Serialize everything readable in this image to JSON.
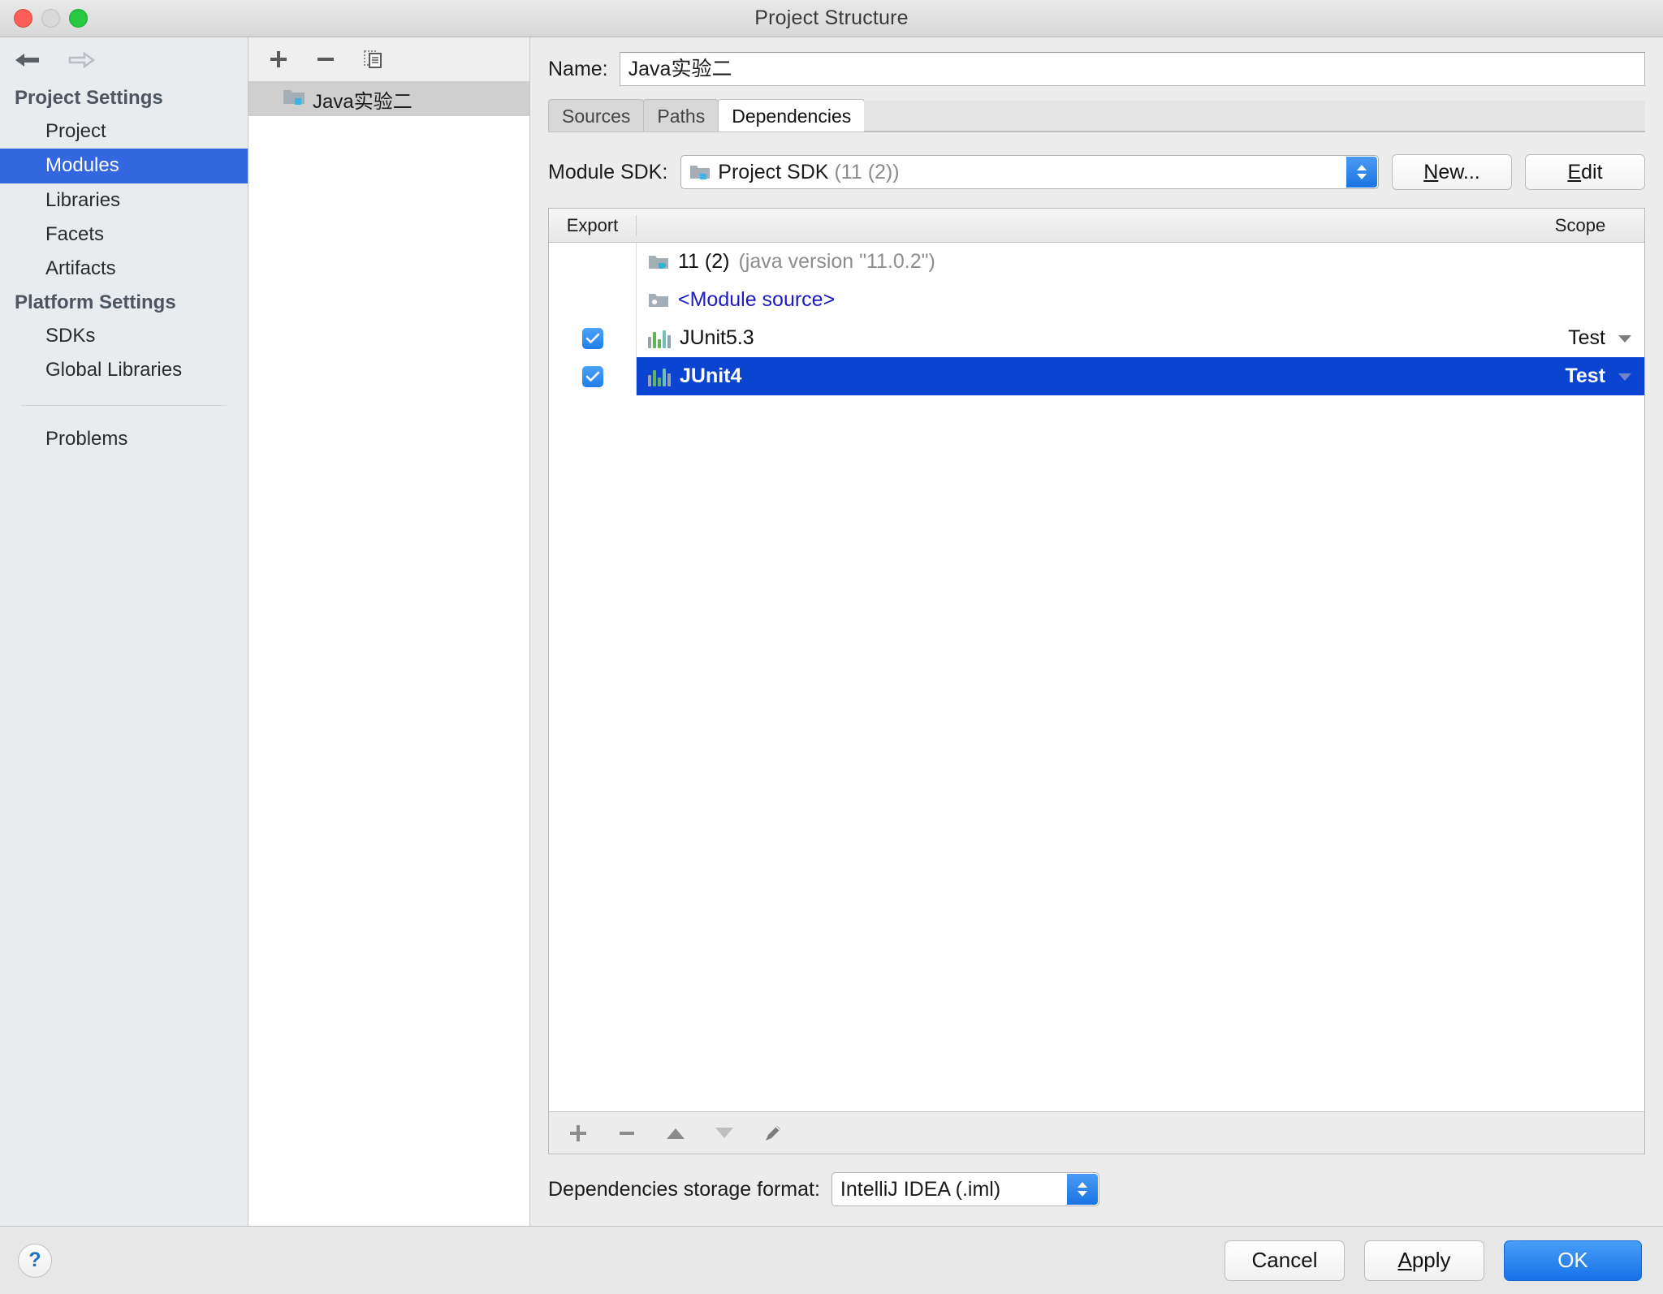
{
  "window": {
    "title": "Project Structure",
    "traffic_lights": [
      "close",
      "minimize",
      "maximize"
    ]
  },
  "nav": {
    "back_icon": "arrow-left-icon",
    "forward_icon": "arrow-right-icon",
    "sections": [
      {
        "title": "Project Settings",
        "items": [
          {
            "label": "Project",
            "selected": false
          },
          {
            "label": "Modules",
            "selected": true
          },
          {
            "label": "Libraries",
            "selected": false
          },
          {
            "label": "Facets",
            "selected": false
          },
          {
            "label": "Artifacts",
            "selected": false
          }
        ]
      },
      {
        "title": "Platform Settings",
        "items": [
          {
            "label": "SDKs",
            "selected": false
          },
          {
            "label": "Global Libraries",
            "selected": false
          }
        ]
      }
    ],
    "extra_items": [
      {
        "label": "Problems",
        "selected": false
      }
    ],
    "selection_color": "#3367e0"
  },
  "modules_panel": {
    "toolbar": [
      {
        "name": "add-module-button",
        "icon": "plus-icon"
      },
      {
        "name": "remove-module-button",
        "icon": "minus-icon"
      },
      {
        "name": "copy-module-button",
        "icon": "copy-icon"
      }
    ],
    "items": [
      {
        "label": "Java实验二",
        "icon": "module-folder-icon",
        "selected": true
      }
    ]
  },
  "detail": {
    "name": {
      "label": "Name:",
      "value": "Java实验二",
      "placeholder": "Module name"
    },
    "tabs": [
      {
        "label": "Sources",
        "active": false
      },
      {
        "label": "Paths",
        "active": false
      },
      {
        "label": "Dependencies",
        "active": true
      }
    ],
    "sdk_row": {
      "label": "Module SDK:",
      "value": "Project SDK",
      "value_detail": "(11 (2))",
      "icon": "sdk-folder-icon",
      "new_button": {
        "prefix": "N",
        "rest": "ew..."
      },
      "edit_button": {
        "prefix": "E",
        "rest": "dit"
      }
    },
    "table": {
      "columns": [
        "Export",
        "",
        "Scope"
      ],
      "rows": [
        {
          "export": null,
          "icon": "jdk-icon",
          "name": "11 (2)",
          "name_detail": "(java version \"11.0.2\")",
          "name_style": "plain",
          "scope": "",
          "has_scope_arrow": false,
          "selected": false
        },
        {
          "export": null,
          "icon": "module-source-icon",
          "name": "<Module source>",
          "name_detail": "",
          "name_style": "link",
          "scope": "",
          "has_scope_arrow": false,
          "selected": false
        },
        {
          "export": true,
          "icon": "library-icon",
          "name": "JUnit5.3",
          "name_detail": "",
          "name_style": "plain",
          "scope": "Test",
          "has_scope_arrow": true,
          "selected": false
        },
        {
          "export": true,
          "icon": "library-icon",
          "name": "JUnit4",
          "name_detail": "",
          "name_style": "plain",
          "scope": "Test",
          "has_scope_arrow": true,
          "selected": true
        }
      ],
      "selection_color": "#0b44d0",
      "footer_buttons": [
        {
          "name": "add-dependency-button",
          "icon": "plus-icon"
        },
        {
          "name": "remove-dependency-button",
          "icon": "minus-icon"
        },
        {
          "name": "move-up-button",
          "icon": "triangle-up-icon"
        },
        {
          "name": "move-down-button",
          "icon": "triangle-down-icon"
        },
        {
          "name": "edit-dependency-button",
          "icon": "pencil-icon"
        }
      ]
    },
    "storage": {
      "label": "Dependencies storage format:",
      "value": "IntelliJ IDEA (.iml)"
    }
  },
  "footer": {
    "help_label": "?",
    "buttons": [
      {
        "label": "Cancel",
        "prefix": "",
        "rest": "Cancel",
        "primary": false
      },
      {
        "label": "Apply",
        "prefix": "A",
        "rest": "pply",
        "primary": false
      },
      {
        "label": "OK",
        "prefix": "",
        "rest": "OK",
        "primary": true
      }
    ],
    "primary_color": "#1572e8"
  }
}
